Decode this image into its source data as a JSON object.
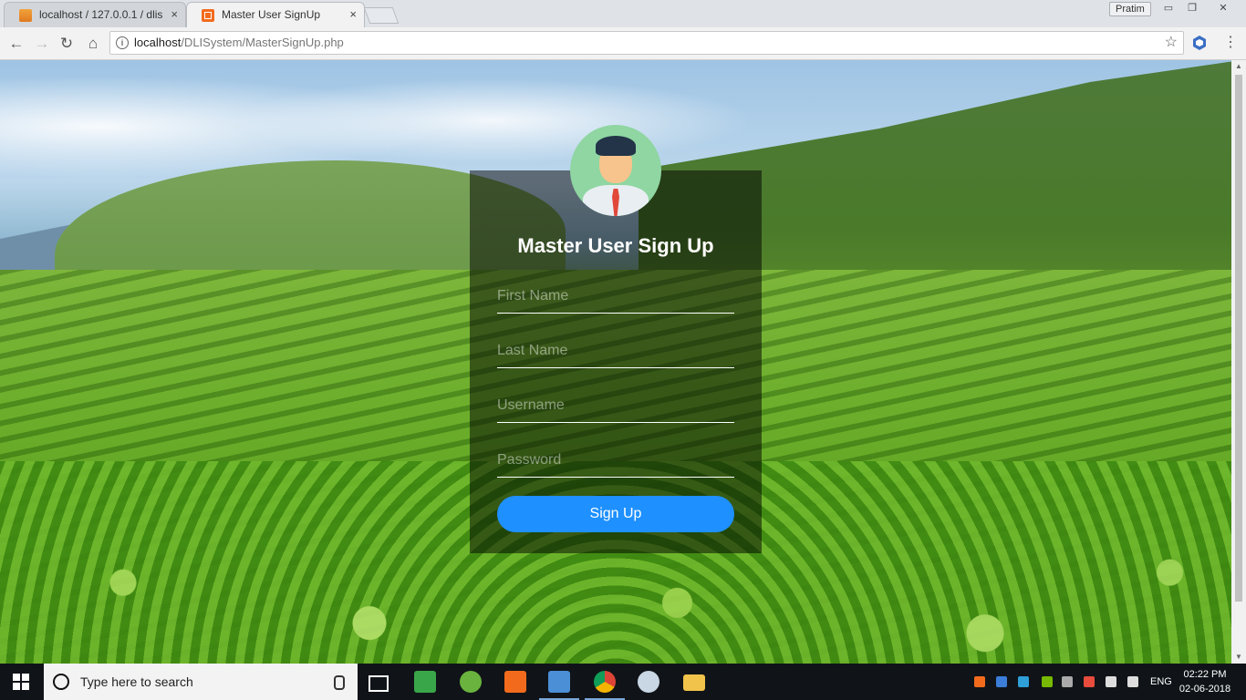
{
  "browser": {
    "tabs": [
      {
        "title": "localhost / 127.0.0.1 / dlis",
        "close": "×"
      },
      {
        "title": "Master User SignUp",
        "close": "×"
      }
    ],
    "profile_name": "Pratim",
    "window_buttons": [
      "▭",
      "❐",
      "✕"
    ],
    "nav": {
      "back": "←",
      "forward": "→",
      "reload": "↻",
      "home": "⌂"
    },
    "url_host": "localhost",
    "url_path": "/DLISystem/MasterSignUp.php",
    "info_icon": "i",
    "bookmark_star": "☆",
    "menu": "⋮"
  },
  "form": {
    "title": "Master User Sign Up",
    "first_name_placeholder": "First Name",
    "last_name_placeholder": "Last Name",
    "username_placeholder": "Username",
    "password_placeholder": "Password",
    "submit_label": "Sign Up"
  },
  "colors": {
    "button": "#1e90ff",
    "panel": "rgba(0,0,0,0.5)"
  },
  "taskbar": {
    "search_placeholder": "Type here to search",
    "language": "ENG",
    "time": "02:22 PM",
    "date": "02-06-2018",
    "apps": [
      "task-view-icon",
      "notepad-icon",
      "utorrent-icon",
      "xampp-icon",
      "virtualbox-icon",
      "chrome-icon",
      "paint-icon",
      "file-explorer-icon"
    ]
  }
}
